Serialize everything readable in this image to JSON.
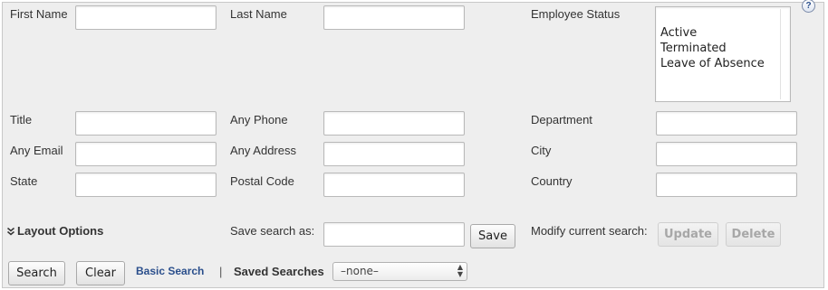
{
  "help_icon": "?",
  "fields": {
    "first_name": {
      "label": "First Name",
      "value": ""
    },
    "last_name": {
      "label": "Last Name",
      "value": ""
    },
    "employee_status": {
      "label": "Employee Status",
      "options": [
        "Active",
        "Terminated",
        "Leave of Absence"
      ]
    },
    "title": {
      "label": "Title",
      "value": ""
    },
    "any_phone": {
      "label": "Any Phone",
      "value": ""
    },
    "department": {
      "label": "Department",
      "value": ""
    },
    "any_email": {
      "label": "Any Email",
      "value": ""
    },
    "any_address": {
      "label": "Any Address",
      "value": ""
    },
    "city": {
      "label": "City",
      "value": ""
    },
    "state": {
      "label": "State",
      "value": ""
    },
    "postal_code": {
      "label": "Postal Code",
      "value": ""
    },
    "country": {
      "label": "Country",
      "value": ""
    }
  },
  "layout_options": {
    "icon": "double-chevron-down-icon",
    "label": "Layout Options"
  },
  "save_search": {
    "label": "Save search as:",
    "value": "",
    "button": "Save"
  },
  "modify_search": {
    "label": "Modify current search:",
    "update_button": "Update",
    "delete_button": "Delete"
  },
  "actions": {
    "search_button": "Search",
    "clear_button": "Clear",
    "basic_search_link": "Basic Search",
    "separator": "|",
    "saved_searches_label": "Saved Searches",
    "saved_searches_selected": "–none–"
  },
  "colors": {
    "panel_bg": "#eeeeee",
    "link": "#2b4f8c",
    "disabled_text": "#a7a7a7"
  }
}
